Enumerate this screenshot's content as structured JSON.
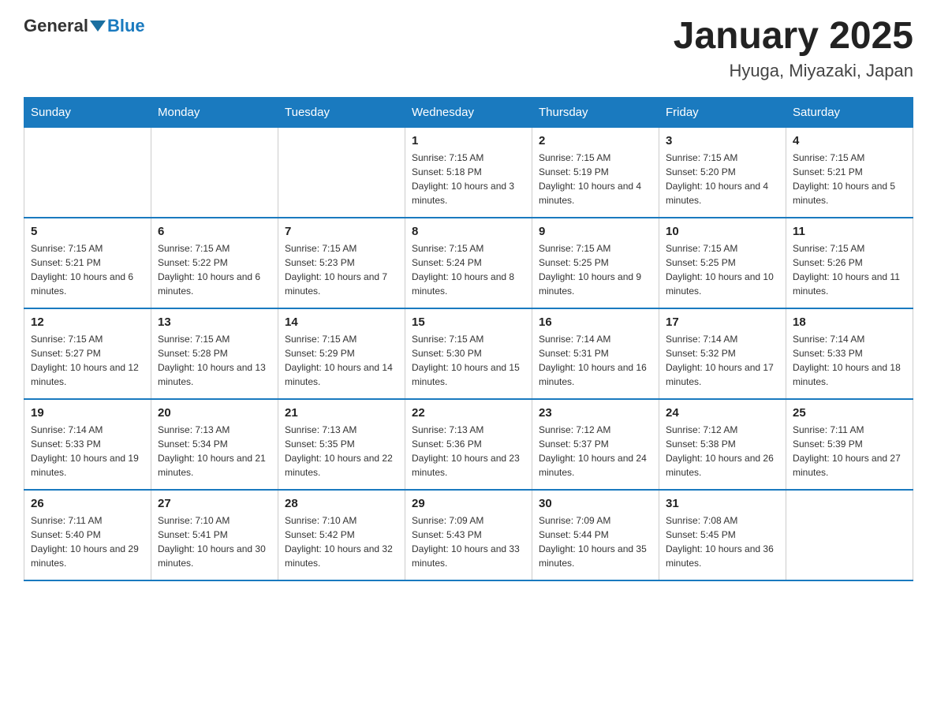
{
  "logo": {
    "general": "General",
    "blue": "Blue"
  },
  "header": {
    "month_title": "January 2025",
    "location": "Hyuga, Miyazaki, Japan"
  },
  "weekdays": [
    "Sunday",
    "Monday",
    "Tuesday",
    "Wednesday",
    "Thursday",
    "Friday",
    "Saturday"
  ],
  "weeks": [
    [
      {
        "day": "",
        "info": ""
      },
      {
        "day": "",
        "info": ""
      },
      {
        "day": "",
        "info": ""
      },
      {
        "day": "1",
        "info": "Sunrise: 7:15 AM\nSunset: 5:18 PM\nDaylight: 10 hours and 3 minutes."
      },
      {
        "day": "2",
        "info": "Sunrise: 7:15 AM\nSunset: 5:19 PM\nDaylight: 10 hours and 4 minutes."
      },
      {
        "day": "3",
        "info": "Sunrise: 7:15 AM\nSunset: 5:20 PM\nDaylight: 10 hours and 4 minutes."
      },
      {
        "day": "4",
        "info": "Sunrise: 7:15 AM\nSunset: 5:21 PM\nDaylight: 10 hours and 5 minutes."
      }
    ],
    [
      {
        "day": "5",
        "info": "Sunrise: 7:15 AM\nSunset: 5:21 PM\nDaylight: 10 hours and 6 minutes."
      },
      {
        "day": "6",
        "info": "Sunrise: 7:15 AM\nSunset: 5:22 PM\nDaylight: 10 hours and 6 minutes."
      },
      {
        "day": "7",
        "info": "Sunrise: 7:15 AM\nSunset: 5:23 PM\nDaylight: 10 hours and 7 minutes."
      },
      {
        "day": "8",
        "info": "Sunrise: 7:15 AM\nSunset: 5:24 PM\nDaylight: 10 hours and 8 minutes."
      },
      {
        "day": "9",
        "info": "Sunrise: 7:15 AM\nSunset: 5:25 PM\nDaylight: 10 hours and 9 minutes."
      },
      {
        "day": "10",
        "info": "Sunrise: 7:15 AM\nSunset: 5:25 PM\nDaylight: 10 hours and 10 minutes."
      },
      {
        "day": "11",
        "info": "Sunrise: 7:15 AM\nSunset: 5:26 PM\nDaylight: 10 hours and 11 minutes."
      }
    ],
    [
      {
        "day": "12",
        "info": "Sunrise: 7:15 AM\nSunset: 5:27 PM\nDaylight: 10 hours and 12 minutes."
      },
      {
        "day": "13",
        "info": "Sunrise: 7:15 AM\nSunset: 5:28 PM\nDaylight: 10 hours and 13 minutes."
      },
      {
        "day": "14",
        "info": "Sunrise: 7:15 AM\nSunset: 5:29 PM\nDaylight: 10 hours and 14 minutes."
      },
      {
        "day": "15",
        "info": "Sunrise: 7:15 AM\nSunset: 5:30 PM\nDaylight: 10 hours and 15 minutes."
      },
      {
        "day": "16",
        "info": "Sunrise: 7:14 AM\nSunset: 5:31 PM\nDaylight: 10 hours and 16 minutes."
      },
      {
        "day": "17",
        "info": "Sunrise: 7:14 AM\nSunset: 5:32 PM\nDaylight: 10 hours and 17 minutes."
      },
      {
        "day": "18",
        "info": "Sunrise: 7:14 AM\nSunset: 5:33 PM\nDaylight: 10 hours and 18 minutes."
      }
    ],
    [
      {
        "day": "19",
        "info": "Sunrise: 7:14 AM\nSunset: 5:33 PM\nDaylight: 10 hours and 19 minutes."
      },
      {
        "day": "20",
        "info": "Sunrise: 7:13 AM\nSunset: 5:34 PM\nDaylight: 10 hours and 21 minutes."
      },
      {
        "day": "21",
        "info": "Sunrise: 7:13 AM\nSunset: 5:35 PM\nDaylight: 10 hours and 22 minutes."
      },
      {
        "day": "22",
        "info": "Sunrise: 7:13 AM\nSunset: 5:36 PM\nDaylight: 10 hours and 23 minutes."
      },
      {
        "day": "23",
        "info": "Sunrise: 7:12 AM\nSunset: 5:37 PM\nDaylight: 10 hours and 24 minutes."
      },
      {
        "day": "24",
        "info": "Sunrise: 7:12 AM\nSunset: 5:38 PM\nDaylight: 10 hours and 26 minutes."
      },
      {
        "day": "25",
        "info": "Sunrise: 7:11 AM\nSunset: 5:39 PM\nDaylight: 10 hours and 27 minutes."
      }
    ],
    [
      {
        "day": "26",
        "info": "Sunrise: 7:11 AM\nSunset: 5:40 PM\nDaylight: 10 hours and 29 minutes."
      },
      {
        "day": "27",
        "info": "Sunrise: 7:10 AM\nSunset: 5:41 PM\nDaylight: 10 hours and 30 minutes."
      },
      {
        "day": "28",
        "info": "Sunrise: 7:10 AM\nSunset: 5:42 PM\nDaylight: 10 hours and 32 minutes."
      },
      {
        "day": "29",
        "info": "Sunrise: 7:09 AM\nSunset: 5:43 PM\nDaylight: 10 hours and 33 minutes."
      },
      {
        "day": "30",
        "info": "Sunrise: 7:09 AM\nSunset: 5:44 PM\nDaylight: 10 hours and 35 minutes."
      },
      {
        "day": "31",
        "info": "Sunrise: 7:08 AM\nSunset: 5:45 PM\nDaylight: 10 hours and 36 minutes."
      },
      {
        "day": "",
        "info": ""
      }
    ]
  ]
}
